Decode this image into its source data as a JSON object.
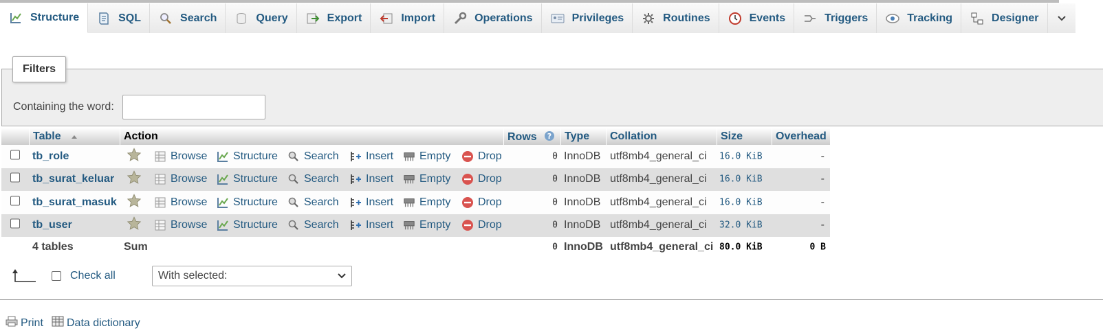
{
  "tabs": [
    {
      "label": "Structure",
      "icon": "structure-icon",
      "active": true
    },
    {
      "label": "SQL",
      "icon": "sql-icon"
    },
    {
      "label": "Search",
      "icon": "search-icon"
    },
    {
      "label": "Query",
      "icon": "query-icon"
    },
    {
      "label": "Export",
      "icon": "export-icon"
    },
    {
      "label": "Import",
      "icon": "import-icon"
    },
    {
      "label": "Operations",
      "icon": "wrench-icon"
    },
    {
      "label": "Privileges",
      "icon": "privileges-icon"
    },
    {
      "label": "Routines",
      "icon": "routines-icon"
    },
    {
      "label": "Events",
      "icon": "clock-icon"
    },
    {
      "label": "Triggers",
      "icon": "triggers-icon"
    },
    {
      "label": "Tracking",
      "icon": "eye-icon"
    },
    {
      "label": "Designer",
      "icon": "designer-icon"
    }
  ],
  "filters": {
    "legend": "Filters",
    "label": "Containing the word:",
    "value": ""
  },
  "table": {
    "headers": {
      "table": "Table",
      "action": "Action",
      "rows": "Rows",
      "type": "Type",
      "collation": "Collation",
      "size": "Size",
      "overhead": "Overhead"
    },
    "actions": {
      "browse": "Browse",
      "structure": "Structure",
      "search": "Search",
      "insert": "Insert",
      "empty": "Empty",
      "drop": "Drop"
    },
    "rows": [
      {
        "name": "tb_role",
        "rows": "0",
        "type": "InnoDB",
        "collation": "utf8mb4_general_ci",
        "size": "16.0 KiB",
        "overhead": "-"
      },
      {
        "name": "tb_surat_keluar",
        "rows": "0",
        "type": "InnoDB",
        "collation": "utf8mb4_general_ci",
        "size": "16.0 KiB",
        "overhead": "-"
      },
      {
        "name": "tb_surat_masuk",
        "rows": "0",
        "type": "InnoDB",
        "collation": "utf8mb4_general_ci",
        "size": "16.0 KiB",
        "overhead": "-"
      },
      {
        "name": "tb_user",
        "rows": "0",
        "type": "InnoDB",
        "collation": "utf8mb4_general_ci",
        "size": "32.0 KiB",
        "overhead": "-"
      }
    ],
    "summary": {
      "tables": "4 tables",
      "action": "Sum",
      "rows": "0",
      "type": "InnoDB",
      "collation": "utf8mb4_general_ci",
      "size": "80.0 KiB",
      "overhead": "0 B"
    }
  },
  "bottom": {
    "check_all": "Check all",
    "with_selected": "With selected:"
  },
  "footer": {
    "print": "Print",
    "data_dictionary": "Data dictionary"
  },
  "colors": {
    "link": "#235a81",
    "header_gradient_bottom": "#cccccc",
    "row_even": "#dfdfdf",
    "drop_red": "#d9534f"
  }
}
